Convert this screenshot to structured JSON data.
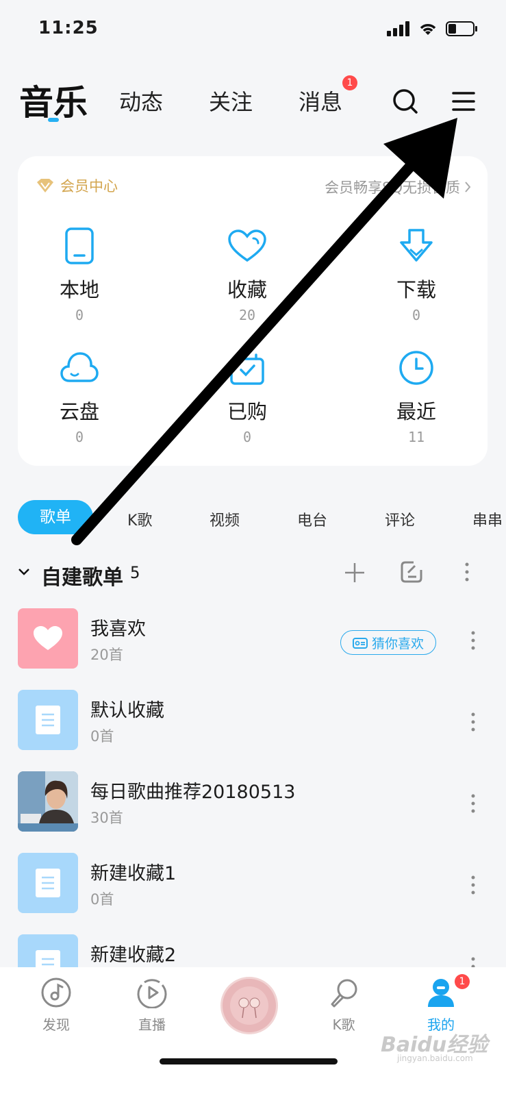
{
  "status_bar": {
    "time": "11:25"
  },
  "top_nav": {
    "tabs": [
      {
        "label": "音乐",
        "active": true
      },
      {
        "label": "动态"
      },
      {
        "label": "关注"
      },
      {
        "label": "消息",
        "badge": "1"
      }
    ],
    "icons": [
      "search-icon",
      "menu-icon"
    ]
  },
  "vip_card": {
    "title": "会员中心",
    "promo": "会员畅享SQ无损音质",
    "items": [
      {
        "label": "本地",
        "count": "0",
        "icon": "phone-icon"
      },
      {
        "label": "收藏",
        "count": "20",
        "icon": "heart-icon"
      },
      {
        "label": "下载",
        "count": "0",
        "icon": "download-icon"
      },
      {
        "label": "云盘",
        "count": "0",
        "icon": "cloud-icon"
      },
      {
        "label": "已购",
        "count": "0",
        "icon": "purchased-icon"
      },
      {
        "label": "最近",
        "count": "11",
        "icon": "clock-icon"
      }
    ]
  },
  "category_tabs": [
    {
      "label": "歌单",
      "active": true
    },
    {
      "label": "K歌"
    },
    {
      "label": "视频"
    },
    {
      "label": "电台"
    },
    {
      "label": "评论"
    },
    {
      "label": "串串"
    }
  ],
  "playlists": {
    "title": "自建歌单",
    "count": "5",
    "items": [
      {
        "name": "我喜欢",
        "sub": "20首",
        "action": "猜你喜欢"
      },
      {
        "name": "默认收藏",
        "sub": "0首"
      },
      {
        "name": "每日歌曲推荐20180513",
        "sub": "30首"
      },
      {
        "name": "新建收藏1",
        "sub": "0首"
      },
      {
        "name": "新建收藏2",
        "sub": ""
      }
    ]
  },
  "tab_bar": {
    "items": [
      {
        "label": "发现",
        "icon": "discover-icon"
      },
      {
        "label": "直播",
        "icon": "live-icon"
      },
      {
        "label": "K歌",
        "icon": "karaoke-icon"
      },
      {
        "label": "我的",
        "icon": "profile-icon",
        "active": true,
        "badge": "1"
      }
    ]
  },
  "watermark": {
    "text": "Baidu经验",
    "sub": "jingyan.baidu.com"
  },
  "colors": {
    "accent": "#20b3f5",
    "vip_gold": "#d3a54e",
    "badge": "#ff4a4a",
    "favorite_cover": "#fda3b0",
    "folder_cover": "#a8d8fb"
  }
}
